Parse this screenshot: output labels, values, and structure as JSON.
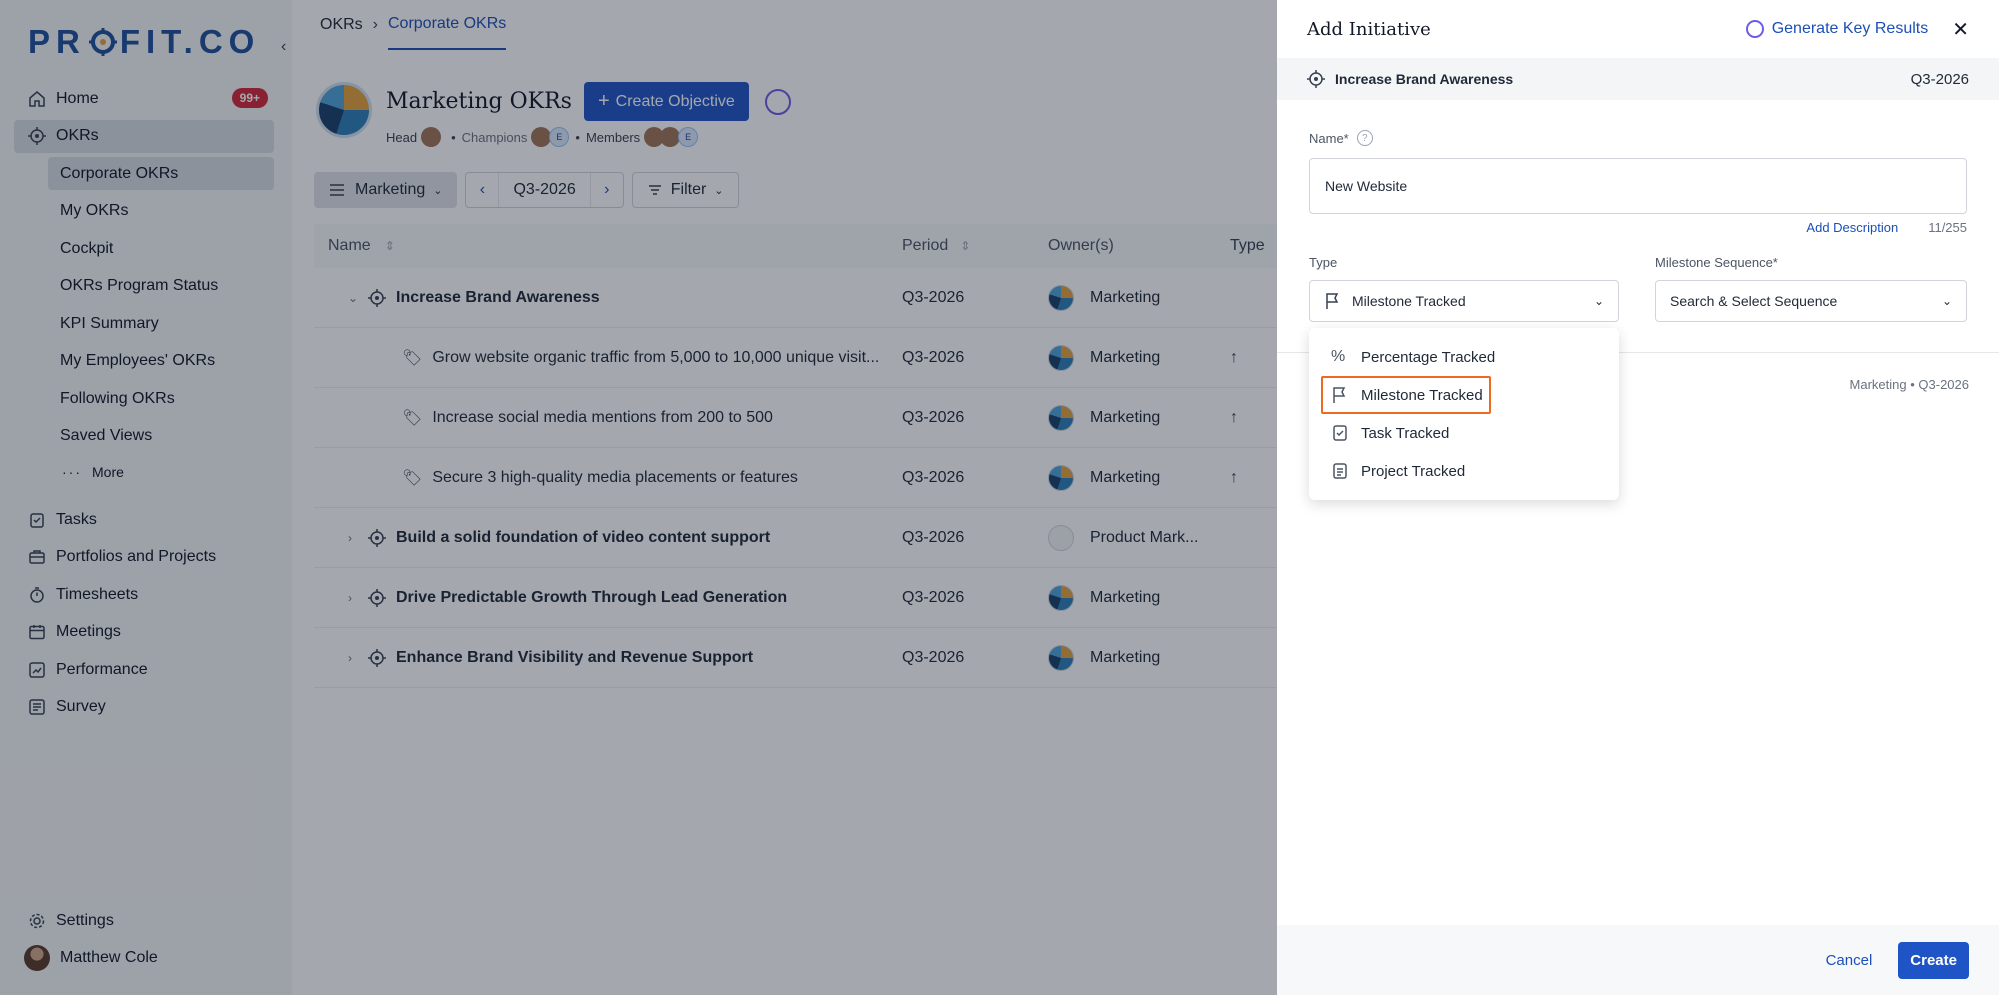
{
  "app": {
    "logo": "PROFIT.CO",
    "logo_before": "PR",
    "logo_after": "FIT.CO"
  },
  "sidebar": {
    "items": [
      {
        "label": "Home",
        "icon": "home-icon",
        "badge": "99+"
      },
      {
        "label": "OKRs",
        "icon": "target-icon"
      }
    ],
    "subitems": [
      "Corporate OKRs",
      "My OKRs",
      "Cockpit",
      "OKRs Program Status",
      "KPI Summary",
      "My Employees' OKRs",
      "Following OKRs",
      "Saved Views"
    ],
    "more": "More",
    "bottom_items": [
      {
        "label": "Tasks",
        "icon": "tasks-icon"
      },
      {
        "label": "Portfolios and Projects",
        "icon": "briefcase-icon"
      },
      {
        "label": "Timesheets",
        "icon": "timer-icon"
      },
      {
        "label": "Meetings",
        "icon": "calendar-icon"
      },
      {
        "label": "Performance",
        "icon": "chart-icon"
      },
      {
        "label": "Survey",
        "icon": "survey-icon"
      }
    ],
    "settings": "Settings",
    "user": "Matthew Cole"
  },
  "breadcrumb": {
    "root": "OKRs",
    "current": "Corporate OKRs"
  },
  "objective_header": {
    "title": "Marketing OKRs",
    "create_button": "Create Objective",
    "head_label": "Head",
    "champions_label": "Champions",
    "members_label": "Members",
    "avatar_initial": "E"
  },
  "toolbar": {
    "team": "Marketing",
    "period": "Q3-2026",
    "filter": "Filter"
  },
  "table": {
    "columns": [
      "Name",
      "Period",
      "Owner(s)",
      "Type"
    ],
    "rows": [
      {
        "name": "Increase Brand Awareness",
        "period": "Q3-2026",
        "owner": "Marketing",
        "level": "objective",
        "expanded": true
      },
      {
        "name": "Grow website organic traffic from 5,000 to 10,000 unique visit...",
        "period": "Q3-2026",
        "owner": "Marketing",
        "level": "kr",
        "type_icon": "arrow-up-icon"
      },
      {
        "name": "Increase social media mentions from 200 to 500",
        "period": "Q3-2026",
        "owner": "Marketing",
        "level": "kr",
        "type_icon": "arrow-up-icon"
      },
      {
        "name": "Secure 3 high-quality media placements or features",
        "period": "Q3-2026",
        "owner": "Marketing",
        "level": "kr",
        "type_icon": "arrow-up-icon"
      },
      {
        "name": "Build a solid foundation of video content support",
        "period": "Q3-2026",
        "owner": "Product Mark...",
        "level": "objective",
        "owner_icon": "wrench-icon"
      },
      {
        "name": "Drive Predictable Growth Through Lead Generation",
        "period": "Q3-2026",
        "owner": "Marketing",
        "level": "objective"
      },
      {
        "name": "Enhance Brand Visibility and Revenue Support",
        "period": "Q3-2026",
        "owner": "Marketing",
        "level": "objective"
      }
    ]
  },
  "panel": {
    "title": "Add Initiative",
    "generate_link": "Generate Key Results",
    "objective": {
      "name": "Increase Brand Awareness",
      "period": "Q3-2026"
    },
    "name_label": "Name*",
    "name_value": "New Website",
    "add_description": "Add Description",
    "char_count": "11/255",
    "type_label": "Type",
    "type_value": "Milestone Tracked",
    "milestone_label": "Milestone Sequence*",
    "milestone_placeholder": "Search & Select Sequence",
    "dropdown_options": [
      "Percentage Tracked",
      "Milestone Tracked",
      "Task Tracked",
      "Project Tracked"
    ],
    "highlighted_option": "Milestone Tracked",
    "kr_meta": "Marketing  • Q3-2026",
    "cancel": "Cancel",
    "create": "Create"
  },
  "colors": {
    "brand": "#1d4f9c",
    "accent": "#1f54c6",
    "badge": "#d62839",
    "highlight": "#ec6a22"
  }
}
